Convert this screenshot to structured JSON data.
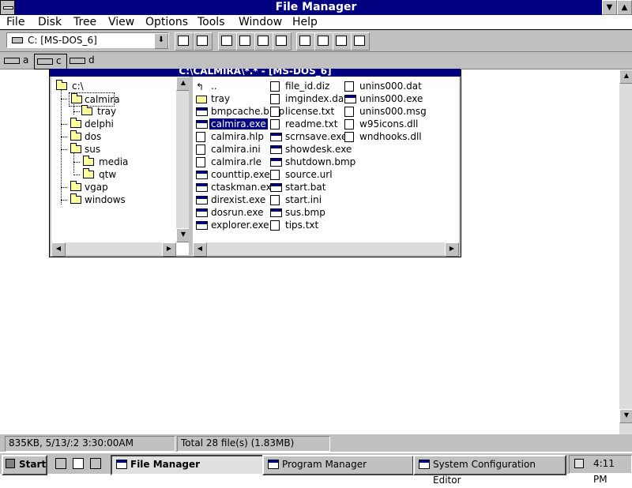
{
  "window": {
    "title": "File Manager"
  },
  "menu": [
    "File",
    "Disk",
    "Tree",
    "View",
    "Options",
    "Tools",
    "Window",
    "Help"
  ],
  "toolbar": {
    "drive_combo": "C: [MS-DOS_6]"
  },
  "drives": [
    {
      "letter": "a",
      "icon": "floppy-drive-icon"
    },
    {
      "letter": "c",
      "icon": "hard-drive-icon"
    },
    {
      "letter": "d",
      "icon": "cdrom-drive-icon"
    }
  ],
  "child": {
    "title": "C:\\CALMIRA\\*.* - [MS-DOS_6]",
    "tree": [
      "c:\\",
      "calmira",
      "tray",
      "delphi",
      "dos",
      "sus",
      "media",
      "qtw",
      "vgap",
      "windows"
    ],
    "files_col1": [
      "..",
      "tray",
      "bmpcache.bmp",
      "calmira.exe",
      "calmira.hlp",
      "calmira.ini",
      "calmira.rle",
      "counttip.exe",
      "ctaskman.exe",
      "direxist.exe",
      "dosrun.exe",
      "explorer.exe"
    ],
    "files_col2": [
      "file_id.diz",
      "imgindex.dat",
      "license.txt",
      "readme.txt",
      "scrnsave.exe",
      "showdesk.exe",
      "shutdown.bmp",
      "source.url",
      "start.bat",
      "start.ini",
      "sus.bmp",
      "tips.txt"
    ],
    "files_col3": [
      "unins000.dat",
      "unins000.exe",
      "unins000.msg",
      "w95icons.dll",
      "wndhooks.dll"
    ],
    "selected_file": "calmira.exe"
  },
  "status": {
    "left": "835KB, 5/13/:2 3:30:00AM",
    "right": "Total 28 file(s) (1.83MB)"
  },
  "taskbar": {
    "start": "Start",
    "tasks": [
      "File Manager",
      "Program Manager",
      "System Configuration Editor"
    ],
    "clock": "4:11 PM"
  }
}
